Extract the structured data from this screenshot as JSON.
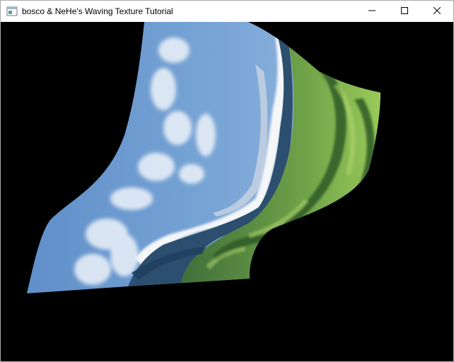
{
  "window": {
    "title": "bosco & NeHe's Waving Texture Tutorial",
    "icon": "application-window-icon",
    "controls": {
      "minimize_icon": "minimize-icon",
      "maximize_icon": "maximize-icon",
      "close_icon": "close-icon"
    }
  },
  "scene": {
    "background_color": "#000000",
    "texture_description_colors": {
      "sky": "#6f9ccd",
      "cloud": "#e8eef6",
      "snow": "#f4f6f8",
      "grass_light": "#8cbf4c",
      "grass_dark": "#2f5f2a"
    }
  }
}
